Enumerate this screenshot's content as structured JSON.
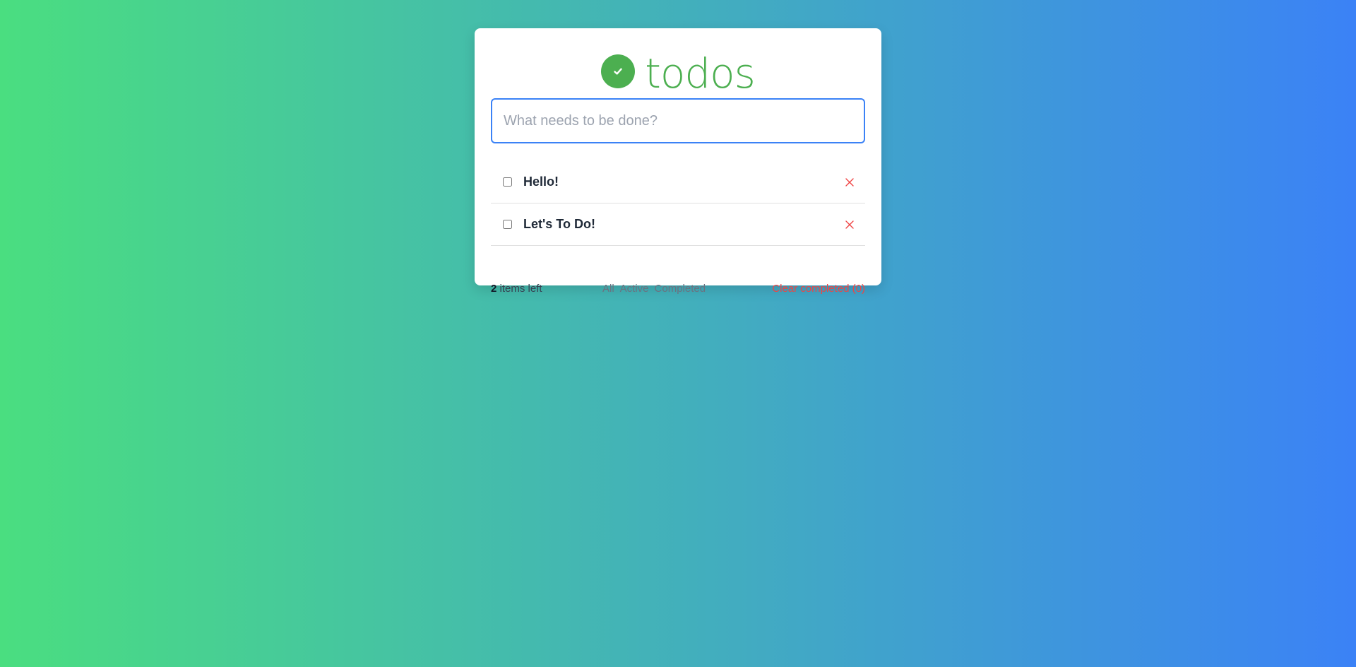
{
  "app": {
    "title": "todos",
    "logo_icon": "check-circle-icon",
    "accent_color": "#4caf50",
    "background_gradient": [
      "#4ade80",
      "#3b82f6"
    ]
  },
  "new_todo": {
    "placeholder": "What needs to be done?",
    "value": ""
  },
  "todos": [
    {
      "text": "Hello!",
      "completed": false
    },
    {
      "text": "Let's To Do!",
      "completed": false
    }
  ],
  "footer": {
    "count": "2",
    "count_label": " items left",
    "filters": [
      "All",
      "Active",
      "Completed"
    ],
    "clear_label": "Clear completed (0)",
    "clear_color": "#ef4444"
  }
}
